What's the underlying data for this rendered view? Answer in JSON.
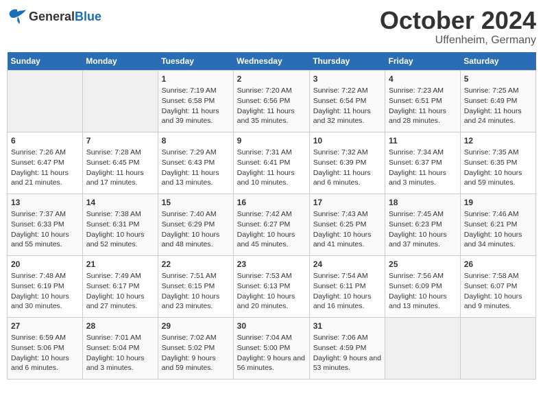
{
  "header": {
    "logo_general": "General",
    "logo_blue": "Blue",
    "month": "October 2024",
    "location": "Uffenheim, Germany"
  },
  "days_of_week": [
    "Sunday",
    "Monday",
    "Tuesday",
    "Wednesday",
    "Thursday",
    "Friday",
    "Saturday"
  ],
  "weeks": [
    [
      {
        "day": "",
        "info": ""
      },
      {
        "day": "",
        "info": ""
      },
      {
        "day": "1",
        "info": "Sunrise: 7:19 AM\nSunset: 6:58 PM\nDaylight: 11 hours and 39 minutes."
      },
      {
        "day": "2",
        "info": "Sunrise: 7:20 AM\nSunset: 6:56 PM\nDaylight: 11 hours and 35 minutes."
      },
      {
        "day": "3",
        "info": "Sunrise: 7:22 AM\nSunset: 6:54 PM\nDaylight: 11 hours and 32 minutes."
      },
      {
        "day": "4",
        "info": "Sunrise: 7:23 AM\nSunset: 6:51 PM\nDaylight: 11 hours and 28 minutes."
      },
      {
        "day": "5",
        "info": "Sunrise: 7:25 AM\nSunset: 6:49 PM\nDaylight: 11 hours and 24 minutes."
      }
    ],
    [
      {
        "day": "6",
        "info": "Sunrise: 7:26 AM\nSunset: 6:47 PM\nDaylight: 11 hours and 21 minutes."
      },
      {
        "day": "7",
        "info": "Sunrise: 7:28 AM\nSunset: 6:45 PM\nDaylight: 11 hours and 17 minutes."
      },
      {
        "day": "8",
        "info": "Sunrise: 7:29 AM\nSunset: 6:43 PM\nDaylight: 11 hours and 13 minutes."
      },
      {
        "day": "9",
        "info": "Sunrise: 7:31 AM\nSunset: 6:41 PM\nDaylight: 11 hours and 10 minutes."
      },
      {
        "day": "10",
        "info": "Sunrise: 7:32 AM\nSunset: 6:39 PM\nDaylight: 11 hours and 6 minutes."
      },
      {
        "day": "11",
        "info": "Sunrise: 7:34 AM\nSunset: 6:37 PM\nDaylight: 11 hours and 3 minutes."
      },
      {
        "day": "12",
        "info": "Sunrise: 7:35 AM\nSunset: 6:35 PM\nDaylight: 10 hours and 59 minutes."
      }
    ],
    [
      {
        "day": "13",
        "info": "Sunrise: 7:37 AM\nSunset: 6:33 PM\nDaylight: 10 hours and 55 minutes."
      },
      {
        "day": "14",
        "info": "Sunrise: 7:38 AM\nSunset: 6:31 PM\nDaylight: 10 hours and 52 minutes."
      },
      {
        "day": "15",
        "info": "Sunrise: 7:40 AM\nSunset: 6:29 PM\nDaylight: 10 hours and 48 minutes."
      },
      {
        "day": "16",
        "info": "Sunrise: 7:42 AM\nSunset: 6:27 PM\nDaylight: 10 hours and 45 minutes."
      },
      {
        "day": "17",
        "info": "Sunrise: 7:43 AM\nSunset: 6:25 PM\nDaylight: 10 hours and 41 minutes."
      },
      {
        "day": "18",
        "info": "Sunrise: 7:45 AM\nSunset: 6:23 PM\nDaylight: 10 hours and 37 minutes."
      },
      {
        "day": "19",
        "info": "Sunrise: 7:46 AM\nSunset: 6:21 PM\nDaylight: 10 hours and 34 minutes."
      }
    ],
    [
      {
        "day": "20",
        "info": "Sunrise: 7:48 AM\nSunset: 6:19 PM\nDaylight: 10 hours and 30 minutes."
      },
      {
        "day": "21",
        "info": "Sunrise: 7:49 AM\nSunset: 6:17 PM\nDaylight: 10 hours and 27 minutes."
      },
      {
        "day": "22",
        "info": "Sunrise: 7:51 AM\nSunset: 6:15 PM\nDaylight: 10 hours and 23 minutes."
      },
      {
        "day": "23",
        "info": "Sunrise: 7:53 AM\nSunset: 6:13 PM\nDaylight: 10 hours and 20 minutes."
      },
      {
        "day": "24",
        "info": "Sunrise: 7:54 AM\nSunset: 6:11 PM\nDaylight: 10 hours and 16 minutes."
      },
      {
        "day": "25",
        "info": "Sunrise: 7:56 AM\nSunset: 6:09 PM\nDaylight: 10 hours and 13 minutes."
      },
      {
        "day": "26",
        "info": "Sunrise: 7:58 AM\nSunset: 6:07 PM\nDaylight: 10 hours and 9 minutes."
      }
    ],
    [
      {
        "day": "27",
        "info": "Sunrise: 6:59 AM\nSunset: 5:06 PM\nDaylight: 10 hours and 6 minutes."
      },
      {
        "day": "28",
        "info": "Sunrise: 7:01 AM\nSunset: 5:04 PM\nDaylight: 10 hours and 3 minutes."
      },
      {
        "day": "29",
        "info": "Sunrise: 7:02 AM\nSunset: 5:02 PM\nDaylight: 9 hours and 59 minutes."
      },
      {
        "day": "30",
        "info": "Sunrise: 7:04 AM\nSunset: 5:00 PM\nDaylight: 9 hours and 56 minutes."
      },
      {
        "day": "31",
        "info": "Sunrise: 7:06 AM\nSunset: 4:59 PM\nDaylight: 9 hours and 53 minutes."
      },
      {
        "day": "",
        "info": ""
      },
      {
        "day": "",
        "info": ""
      }
    ]
  ]
}
